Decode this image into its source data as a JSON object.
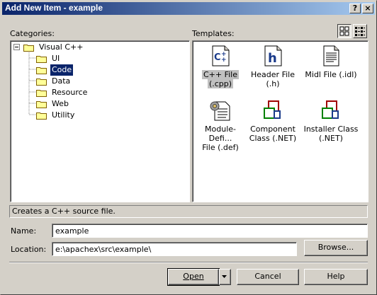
{
  "window": {
    "title": "Add New Item - example"
  },
  "labels": {
    "categories": "Categories:",
    "templates": "Templates:",
    "name": "Name:",
    "location": "Location:"
  },
  "tree": {
    "root": "Visual C++",
    "children": [
      "UI",
      "Code",
      "Data",
      "Resource",
      "Web",
      "Utility"
    ],
    "selected": "Code"
  },
  "templates": [
    {
      "line1": "C++ File",
      "line2": "(.cpp)",
      "icon": "cpp-file-icon"
    },
    {
      "line1": "Header File",
      "line2": "(.h)",
      "icon": "header-file-icon"
    },
    {
      "line1": "Midl File (.idl)",
      "line2": "",
      "icon": "midl-file-icon"
    },
    {
      "line1": "Module-Defi...",
      "line2": "File (.def)",
      "icon": "module-definition-icon"
    },
    {
      "line1": "Component",
      "line2": "Class (.NET)",
      "icon": "component-class-icon"
    },
    {
      "line1": "Installer Class",
      "line2": "(.NET)",
      "icon": "installer-class-icon"
    }
  ],
  "status_text": "Creates a C++ source file.",
  "fields": {
    "name_value": "example",
    "location_value": "e:\\apachex\\src\\example\\"
  },
  "buttons": {
    "browse": "Browse...",
    "open": "Open",
    "cancel": "Cancel",
    "help": "Help"
  },
  "colors": {
    "title_start": "#0a246a",
    "title_end": "#a6caf0",
    "selection": "#0a246a"
  }
}
